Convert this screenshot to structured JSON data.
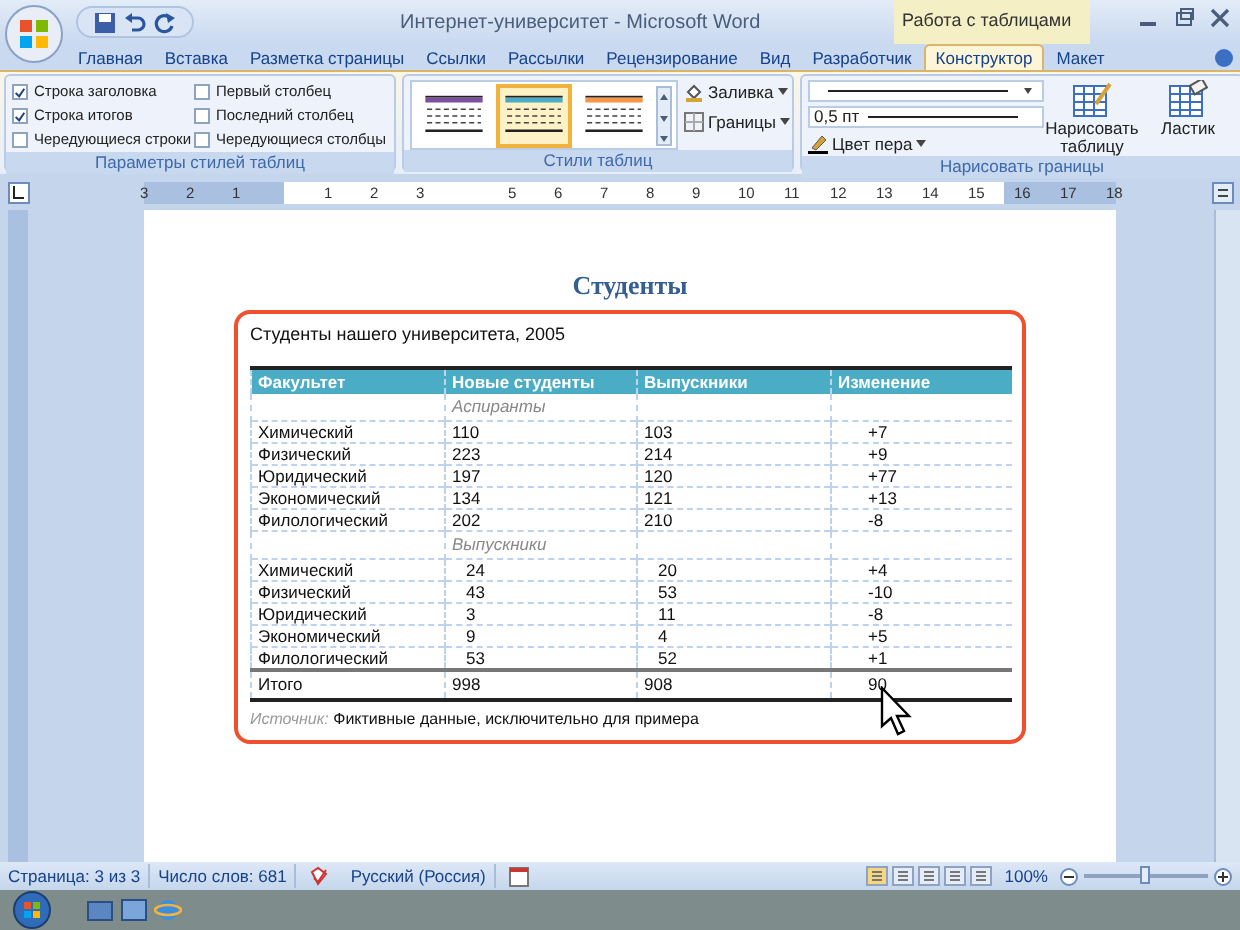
{
  "window": {
    "title": "Интернет-университет - Microsoft Word",
    "contextual_group": "Работа с таблицами"
  },
  "tabs": [
    {
      "label": "Главная",
      "selected": false
    },
    {
      "label": "Вставка",
      "selected": false
    },
    {
      "label": "Разметка страницы",
      "selected": false
    },
    {
      "label": "Ссылки",
      "selected": false
    },
    {
      "label": "Рассылки",
      "selected": false
    },
    {
      "label": "Рецензирование",
      "selected": false
    },
    {
      "label": "Вид",
      "selected": false
    },
    {
      "label": "Разработчик",
      "selected": false
    },
    {
      "label": "Конструктор",
      "selected": true
    },
    {
      "label": "Макет",
      "selected": false
    }
  ],
  "ribbon": {
    "style_options": {
      "label": "Параметры стилей таблиц",
      "checkboxes": [
        {
          "label": "Строка заголовка",
          "checked": true
        },
        {
          "label": "Строка итогов",
          "checked": true
        },
        {
          "label": "Чередующиеся строки",
          "checked": false
        },
        {
          "label": "Первый столбец",
          "checked": false
        },
        {
          "label": "Последний столбец",
          "checked": false
        },
        {
          "label": "Чередующиеся столбцы",
          "checked": false
        }
      ]
    },
    "table_styles": {
      "label": "Стили таблиц",
      "styles": [
        {
          "color": "#7b4f9e",
          "selected": false
        },
        {
          "color": "#4bacc6",
          "selected": true
        },
        {
          "color": "#f79646",
          "selected": false
        }
      ],
      "buttons": [
        "Заливка",
        "Границы"
      ]
    },
    "draw_borders": {
      "label": "Нарисовать границы",
      "line_weight": "0,5 пт",
      "pen_color": "Цвет пера",
      "buttons": [
        "Нарисовать таблицу",
        "Ластик"
      ]
    }
  },
  "ruler": [
    "3",
    "2",
    "1",
    "1",
    "2",
    "3",
    "5",
    "6",
    "7",
    "8",
    "9",
    "10",
    "11",
    "12",
    "13",
    "14",
    "15",
    "16",
    "17",
    "18"
  ],
  "document": {
    "heading": "Студенты",
    "caption": "Студенты нашего университета, 2005",
    "columns": [
      "Факультет",
      "Новые студенты",
      "Выпускники",
      "Изменение"
    ],
    "sections": [
      {
        "label": "Аспиранты",
        "rows": [
          [
            "Химический",
            "110",
            "103",
            "+7"
          ],
          [
            "Физический",
            "223",
            "214",
            "+9"
          ],
          [
            "Юридический",
            "197",
            "120",
            "+77"
          ],
          [
            "Экономический",
            "134",
            "121",
            "+13"
          ],
          [
            "Филологический",
            "202",
            "210",
            "-8"
          ]
        ]
      },
      {
        "label": "Выпускники",
        "rows": [
          [
            "Химический",
            "24",
            "20",
            "+4"
          ],
          [
            "Физический",
            "43",
            "53",
            "-10"
          ],
          [
            "Юридический",
            "3",
            "11",
            "-8"
          ],
          [
            "Экономический",
            "9",
            "4",
            "+5"
          ],
          [
            "Филологический",
            "53",
            "52",
            "+1"
          ]
        ]
      }
    ],
    "total": [
      "Итого",
      "998",
      "908",
      "90"
    ],
    "source_label": "Источник:",
    "source_text": "Фиктивные данные, исключительно для примера"
  },
  "status_bar": {
    "page": "Страница: 3 из 3",
    "words": "Число слов: 681",
    "language": "Русский (Россия)",
    "zoom": "100%",
    "zoom_slider": {
      "level": 0.5
    }
  }
}
